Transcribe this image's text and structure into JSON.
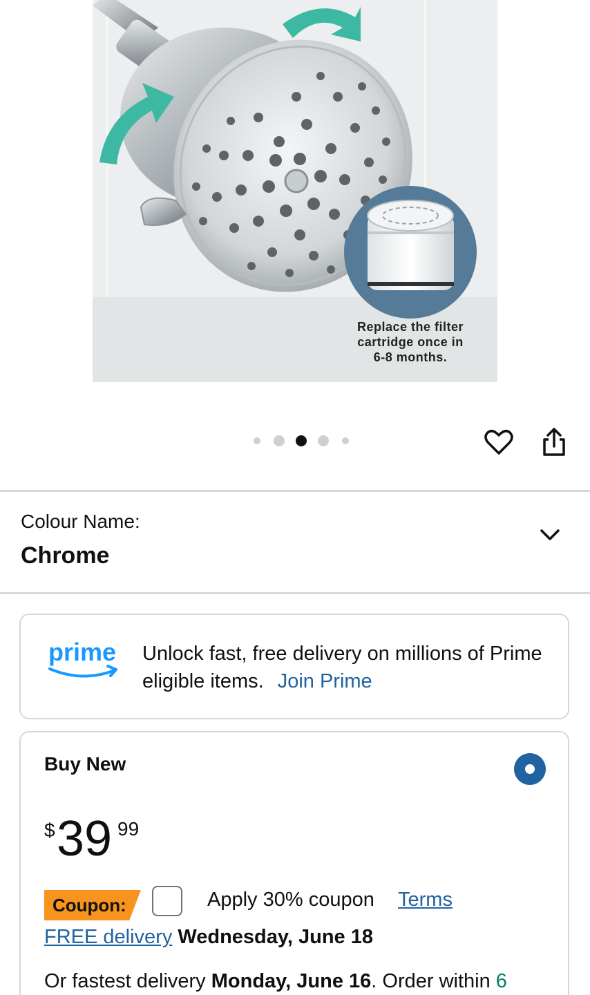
{
  "product_image": {
    "filter_caption": [
      "Replace the filter",
      "cartridge once in",
      "6-8 months."
    ],
    "accent_color": "#3db9a3",
    "filter_circle_color": "#557b98"
  },
  "carousel": {
    "total_dots": 5,
    "active_index": 2
  },
  "actions": {
    "favorite_icon": "heart-icon",
    "share_icon": "share-icon"
  },
  "colour": {
    "label": "Colour Name:",
    "value": "Chrome"
  },
  "prime": {
    "logo_text": "prime",
    "message": "Unlock fast, free delivery on millions of Prime eligible items.",
    "link": "Join Prime",
    "brand_color": "#1a98ff"
  },
  "buy_new": {
    "title": "Buy New",
    "selected": true,
    "price": {
      "symbol": "$",
      "whole": "39",
      "fraction": "99"
    },
    "coupon": {
      "badge": "Coupon:",
      "text": "Apply 30% coupon",
      "terms": "Terms",
      "checked": false,
      "badge_color": "#f8941d"
    },
    "delivery": {
      "link": "FREE delivery",
      "date": "Wednesday, June 18"
    },
    "fastest": {
      "prefix": "Or fastest delivery",
      "date": "Monday, June 16",
      "suffix": ". Order within",
      "countdown": "6"
    }
  },
  "colors": {
    "link": "#2162a1",
    "divider": "#d5d9d9",
    "radio": "#2162a1"
  }
}
